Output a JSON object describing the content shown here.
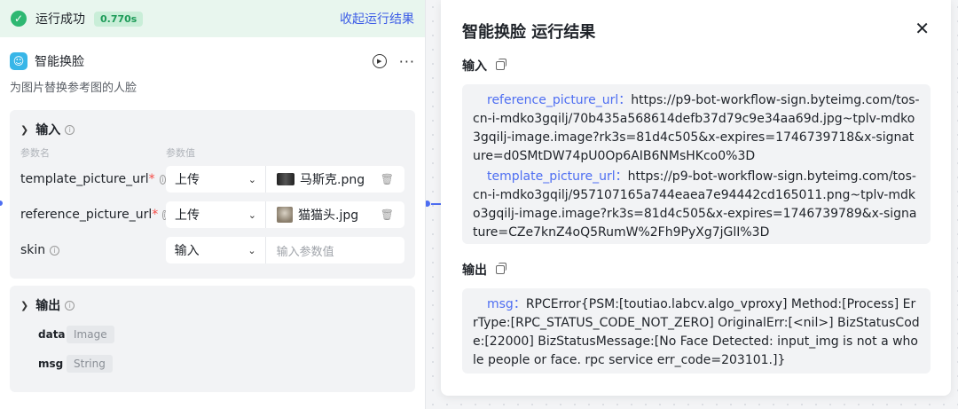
{
  "status": {
    "text": "运行成功",
    "time": "0.770s",
    "collapse_label": "收起运行结果"
  },
  "node": {
    "title": "智能换脸",
    "description": "为图片替换参考图的人脸",
    "input_section": {
      "label": "输入",
      "col_name": "参数名",
      "col_value": "参数值",
      "params": [
        {
          "name": "template_picture_url",
          "required": "*",
          "mode": "上传",
          "value": "马斯克.png"
        },
        {
          "name": "reference_picture_url",
          "required": "*",
          "mode": "上传",
          "value": "猫猫头.jpg"
        },
        {
          "name": "skin",
          "required": "",
          "mode": "输入",
          "placeholder": "输入参数值"
        }
      ]
    },
    "output_section": {
      "label": "输出",
      "fields": [
        {
          "name": "data",
          "type": "Image"
        },
        {
          "name": "msg",
          "type": "String"
        }
      ]
    }
  },
  "panel": {
    "title": "智能换脸 运行结果",
    "input_label": "输入",
    "output_label": "输出",
    "inputs": [
      {
        "key": "reference_picture_url：",
        "value": "https://p9-bot-workflow-sign.byteimg.com/tos-cn-i-mdko3gqilj/70b435a568614defb37d79c9e34aa69d.jpg~tplv-mdko3gqilj-image.image?rk3s=81d4c505&x-expires=1746739718&x-signature=d0SMtDW74pU0Op6AIB6NMsHKco0%3D"
      },
      {
        "key": "template_picture_url：",
        "value": "https://p9-bot-workflow-sign.byteimg.com/tos-cn-i-mdko3gqilj/957107165a744eaea7e94442cd165011.png~tplv-mdko3gqilj-image.image?rk3s=81d4c505&x-expires=1746739789&x-signature=CZe7knZ4oQ5RumW%2Fh9PyXg7jGlI%3D"
      }
    ],
    "outputs": [
      {
        "key": "msg：",
        "value": "RPCError{PSM:[toutiao.labcv.algo_vproxy] Method:[Process] ErrType:[RPC_STATUS_CODE_NOT_ZERO] OriginalErr:[<nil>] BizStatusCode:[22000] BizStatusMessage:[No Face Detected: input_img is not a whole people or face. rpc service err_code=203101.]}"
      }
    ]
  },
  "colors": {
    "success": "#2eb872",
    "accent": "#3c5ce6",
    "key_blue": "#4e6ef2",
    "required": "#f54a45"
  },
  "icons": [
    "check-circle-icon",
    "face-swap-logo-icon",
    "play-icon",
    "more-icon",
    "info-icon",
    "chevron-down-icon",
    "trash-icon",
    "copy-icon",
    "close-icon"
  ]
}
